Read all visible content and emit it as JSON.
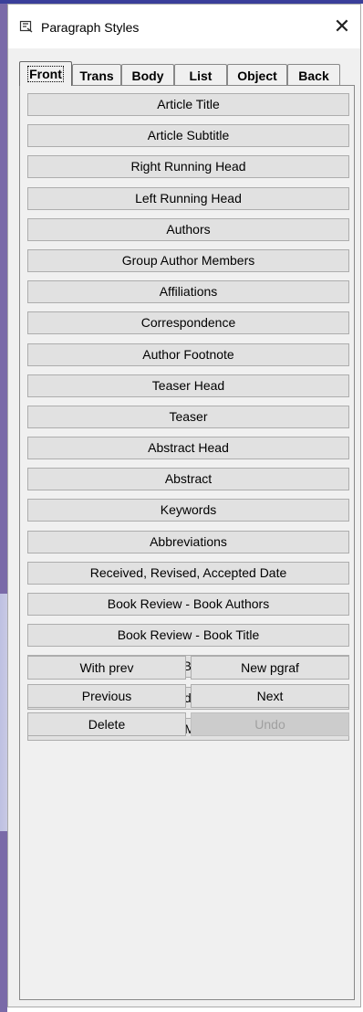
{
  "window": {
    "title": "Paragraph Styles",
    "close_glyph": "✕"
  },
  "tabs": [
    "Front",
    "Trans",
    "Body",
    "List",
    "Object",
    "Back"
  ],
  "active_tab": "Front",
  "styles": [
    "Article Title",
    "Article Subtitle",
    "Right Running Head",
    "Left Running Head",
    "Authors",
    "Group Author Members",
    "Affiliations",
    "Correspondence",
    "Author Footnote",
    "Teaser Head",
    "Teaser",
    "Abstract Head",
    "Abstract",
    "Keywords",
    "Abbreviations",
    "Received, Revised, Accepted Date",
    "Book Review - Book Authors",
    "Book Review - Book Title",
    "Book Review - Book Information",
    "Related Article",
    "Non-XML Text"
  ],
  "nav": {
    "with_prev": "With prev",
    "new_pgraf": "New pgraf",
    "previous": "Previous",
    "next": "Next",
    "delete": "Delete",
    "undo": "Undo"
  }
}
